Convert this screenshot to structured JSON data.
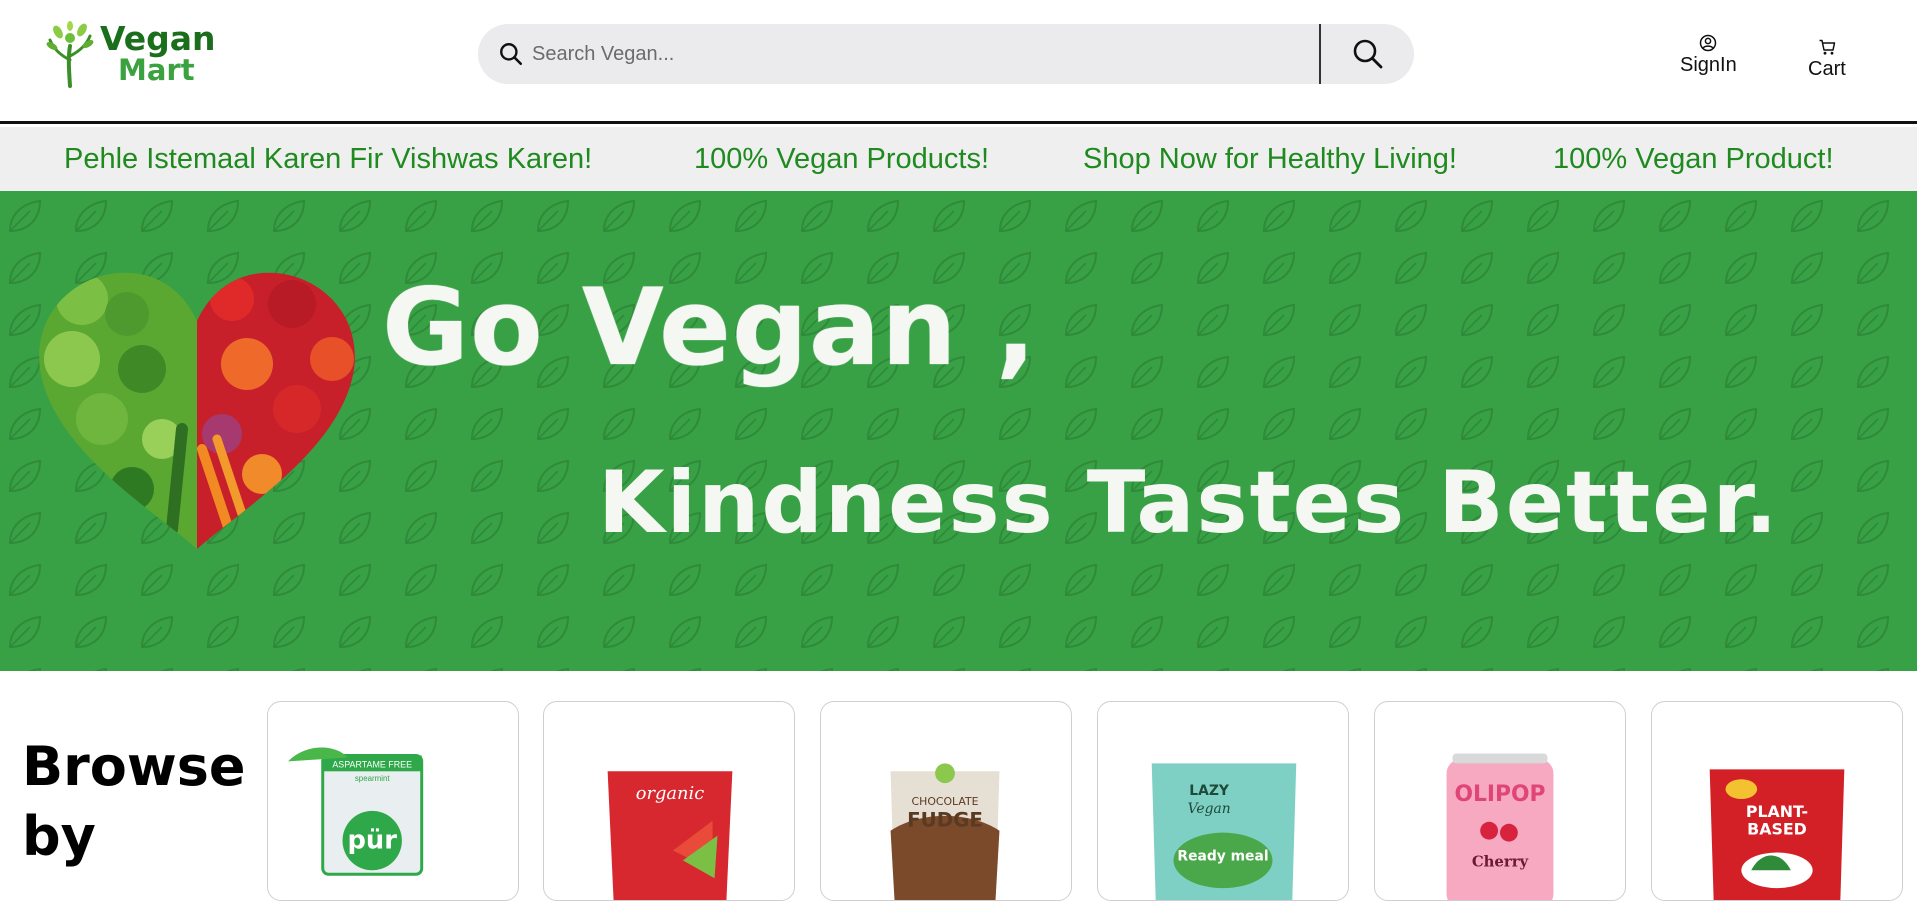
{
  "brand": {
    "line1": "Vegan",
    "line2": "Mart"
  },
  "search": {
    "placeholder": "Search Vegan..."
  },
  "nav": {
    "signin_label": "SignIn",
    "cart_label": "Cart"
  },
  "ticker": [
    "Pehle Istemaal Karen Fir Vishwas Karen!",
    "100% Vegan Products!",
    "Shop Now for Healthy Living!",
    "100% Vegan Product!"
  ],
  "hero": {
    "line1": "Go Vegan ,",
    "line2": "Kindness Tastes Better."
  },
  "browse": {
    "title": "Browse by"
  },
  "products": [
    {
      "label_lines": [
        "ASPARTAME FREE",
        "pür",
        "spearmint"
      ],
      "color": "#2fa84a"
    },
    {
      "label_lines": [
        "organic"
      ],
      "color": "#d7282f"
    },
    {
      "label_lines": [
        "CHOCOLATE",
        "FUDGE"
      ],
      "color": "#7a4a2a"
    },
    {
      "label_lines": [
        "LAZY",
        "Vegan",
        "Ready meal"
      ],
      "color": "#7fd0c4"
    },
    {
      "label_lines": [
        "OLIPOP",
        "Cherry"
      ],
      "color": "#f6a9c0"
    },
    {
      "label_lines": [
        "PLANT-",
        "BASED"
      ],
      "color": "#d32026"
    }
  ],
  "colors": {
    "brand_dark": "#1b6e1b",
    "brand_light": "#3aa23f",
    "hero_bg": "#38a045",
    "ticker_text": "#1f8a1f"
  }
}
